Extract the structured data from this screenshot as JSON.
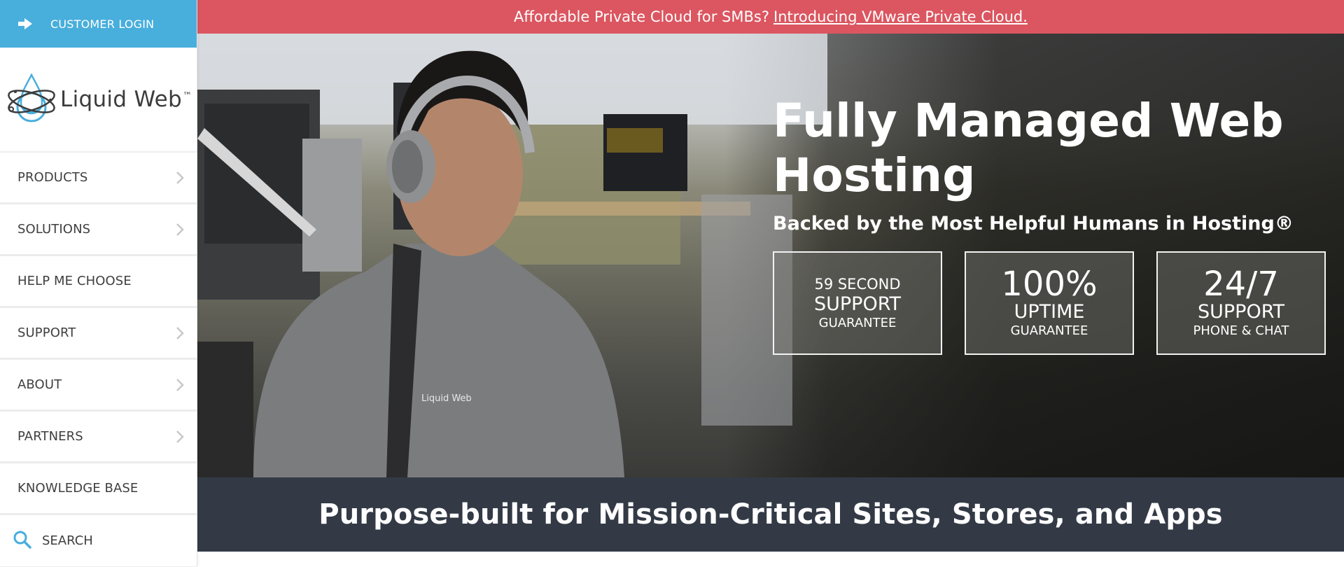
{
  "sidebar": {
    "login": {
      "label": "CUSTOMER LOGIN",
      "icon": "arrow-right-icon"
    },
    "logo": {
      "name": "Liquid Web",
      "trademark": "™"
    },
    "nav": [
      {
        "label": "PRODUCTS",
        "has_submenu": true
      },
      {
        "label": "SOLUTIONS",
        "has_submenu": true
      },
      {
        "label": "HELP ME CHOOSE",
        "has_submenu": false
      },
      {
        "label": "SUPPORT",
        "has_submenu": true
      },
      {
        "label": "ABOUT",
        "has_submenu": true
      },
      {
        "label": "PARTNERS",
        "has_submenu": true
      },
      {
        "label": "KNOWLEDGE BASE",
        "has_submenu": false
      }
    ],
    "search": {
      "label": "SEARCH",
      "icon": "search-icon"
    }
  },
  "banner": {
    "text": "Affordable Private Cloud for SMBs?",
    "link": "Introducing VMware Private Cloud."
  },
  "hero": {
    "title_line1": "Fully Managed Web",
    "title_line2": "Hosting",
    "subtitle": "Backed by the Most Helpful Humans in Hosting®",
    "features": [
      {
        "top": "59 SECOND",
        "middle": "SUPPORT",
        "bottom": "GUARANTEE"
      },
      {
        "top": "100%",
        "middle": "UPTIME",
        "bottom": "GUARANTEE"
      },
      {
        "top": "24/7",
        "middle": "SUPPORT",
        "bottom": "PHONE & CHAT"
      }
    ],
    "image_alt": "Support technician wearing headphones working at a computer in an office"
  },
  "tagline": {
    "text": "Purpose-built for Mission-Critical Sites, Stores, and Apps"
  },
  "colors": {
    "login_bg": "#48aedc",
    "banner_bg": "#db5660",
    "band_bg": "#333a46",
    "nav_text": "#3f3f3f",
    "accent_blue": "#48aedc"
  }
}
